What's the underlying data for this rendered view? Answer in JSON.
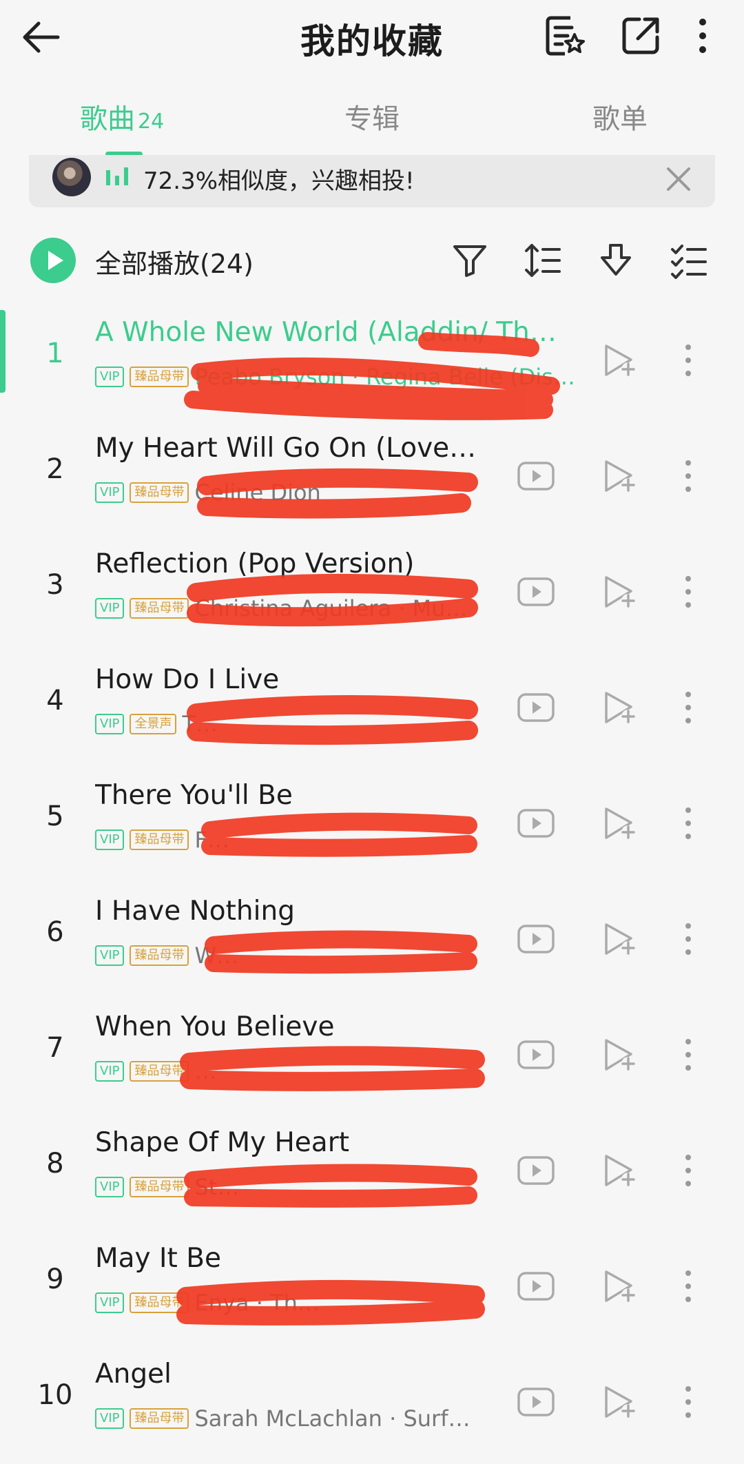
{
  "header": {
    "title": "我的收藏",
    "icons": [
      "back-arrow-icon",
      "playlist-star-icon",
      "share-icon",
      "more-vertical-icon"
    ]
  },
  "tabs": [
    {
      "label": "歌曲",
      "count": "24",
      "active": true
    },
    {
      "label": "专辑",
      "count": "",
      "active": false
    },
    {
      "label": "歌单",
      "count": "",
      "active": false
    }
  ],
  "banner": {
    "text": "72.3%相似度，兴趣相投!"
  },
  "toolbar": {
    "play_all_label": "全部播放(24)",
    "icons": [
      "filter-icon",
      "sort-icon",
      "download-icon",
      "multi-select-icon"
    ]
  },
  "colors": {
    "accent": "#3ccc8e",
    "quality_badge": "#d8a13a",
    "redaction": "#f03a22"
  },
  "songs": [
    {
      "num": "1",
      "title": "A Whole New World (Aladdin/ Th…",
      "vip": "VIP",
      "quality": "臻品母带",
      "artist": "Peabo Bryson · Regina Belle (Disne…",
      "playing": true,
      "has_mv": false
    },
    {
      "num": "2",
      "title": "My Heart Will Go On (Love…",
      "vip": "VIP",
      "quality": "臻品母带",
      "artist": "Celine Dion",
      "playing": false,
      "has_mv": true
    },
    {
      "num": "3",
      "title": "Reflection (Pop Version)",
      "vip": "VIP",
      "quality": "臻品母带",
      "artist": "Christina Aguilera · Mula…",
      "playing": false,
      "has_mv": true
    },
    {
      "num": "4",
      "title": "How Do I Live",
      "vip": "VIP",
      "quality": "全景声",
      "artist": "T…",
      "playing": false,
      "has_mv": true
    },
    {
      "num": "5",
      "title": "There You'll Be",
      "vip": "VIP",
      "quality": "臻品母带",
      "artist": "F…",
      "playing": false,
      "has_mv": true
    },
    {
      "num": "6",
      "title": "I Have Nothing",
      "vip": "VIP",
      "quality": "臻品母带",
      "artist": "W…",
      "playing": false,
      "has_mv": true
    },
    {
      "num": "7",
      "title": "When You Believe",
      "vip": "VIP",
      "quality": "臻品母带",
      "artist": "…",
      "playing": false,
      "has_mv": true
    },
    {
      "num": "8",
      "title": "Shape Of My Heart",
      "vip": "VIP",
      "quality": "臻品母带",
      "artist": "St…",
      "playing": false,
      "has_mv": true
    },
    {
      "num": "9",
      "title": "May It Be",
      "vip": "VIP",
      "quality": "臻品母带",
      "artist": "Enya · Th…",
      "playing": false,
      "has_mv": true
    },
    {
      "num": "10",
      "title": "Angel",
      "vip": "VIP",
      "quality": "臻品母带",
      "artist": "Sarah McLachlan · Surfa…",
      "playing": false,
      "has_mv": true
    }
  ]
}
